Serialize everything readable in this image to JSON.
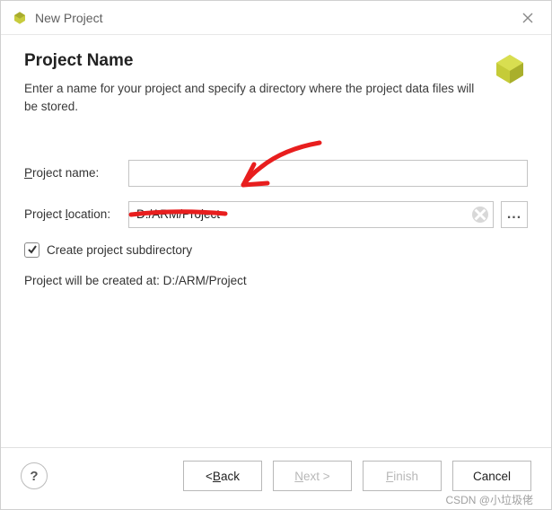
{
  "window": {
    "title": "New Project"
  },
  "header": {
    "title": "Project Name",
    "description": "Enter a name for your project and specify a directory where the project data files will be stored."
  },
  "form": {
    "projectName": {
      "label_pre": "P",
      "label_post": "roject name:",
      "value": ""
    },
    "projectLocation": {
      "label_pre": "Project ",
      "label_acc": "l",
      "label_post": "ocation:",
      "value": "D:/ARM/Project"
    },
    "createSubdir": {
      "checked": true,
      "label": "Create project subdirectory"
    },
    "createdAt": {
      "prefix": "Project will be created at: ",
      "path": "D:/ARM/Project"
    }
  },
  "buttons": {
    "back": {
      "lt": "< ",
      "acc": "B",
      "rest": "ack"
    },
    "next": {
      "acc": "N",
      "rest": "ext >"
    },
    "finish": {
      "acc": "F",
      "rest": "inish"
    },
    "cancel": "Cancel",
    "help": "?",
    "browse": "..."
  },
  "watermark": "CSDN @小垃圾佬"
}
